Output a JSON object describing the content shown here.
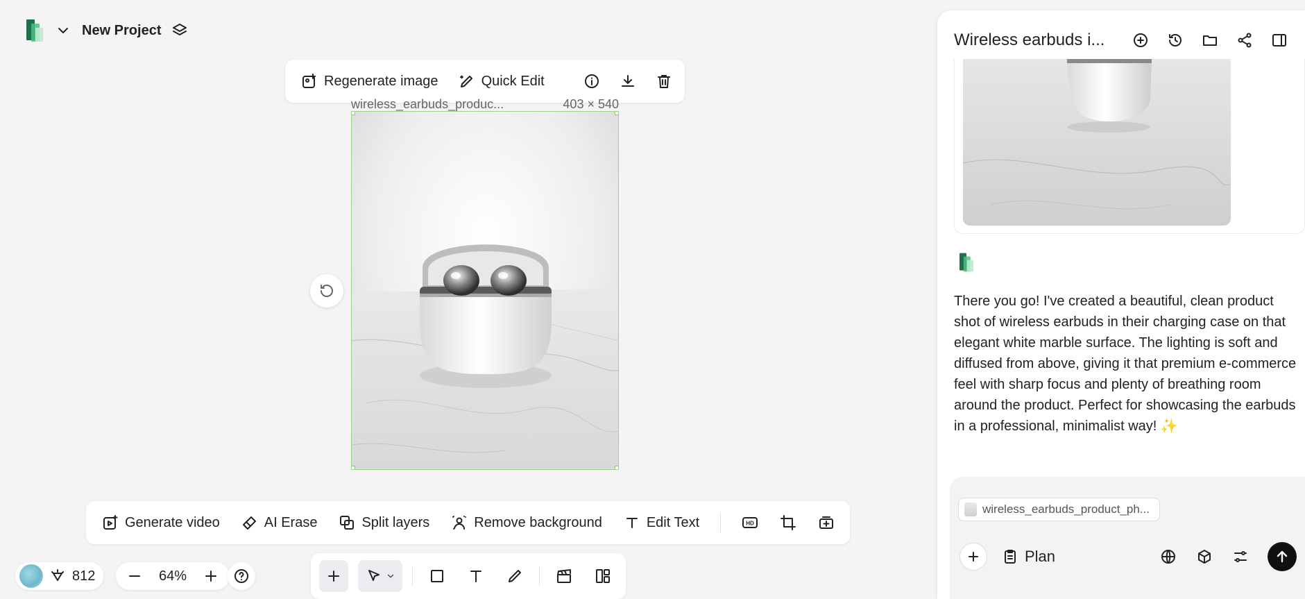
{
  "header": {
    "project_name": "New Project"
  },
  "image_toolbar": {
    "regenerate_label": "Regenerate image",
    "quick_edit_label": "Quick Edit"
  },
  "canvas": {
    "image_name": "wireless_earbuds_produc...",
    "image_dimensions": "403 × 540"
  },
  "action_bar": {
    "generate_video": "Generate video",
    "ai_erase": "AI Erase",
    "split_layers": "Split layers",
    "remove_background": "Remove background",
    "edit_text": "Edit Text",
    "hd_badge": "HD"
  },
  "footer": {
    "credits": "812",
    "zoom": "64%"
  },
  "panel": {
    "title": "Wireless earbuds i...",
    "assistant_message": "There you go! I've created a beautiful, clean product shot of wireless earbuds in their charging case on that elegant white marble surface. The lighting is soft and diffused from above, giving it that premium e-commerce feel with sharp focus and plenty of breathing room around the product. Perfect for showcasing the earbuds in a professional, minimalist way! ✨",
    "attachment": "wireless_earbuds_product_ph...",
    "plan_label": "Plan"
  },
  "colors": {
    "selection_border": "#9bd38a",
    "brand_green": "#1e8a5a",
    "send_button": "#111111"
  }
}
